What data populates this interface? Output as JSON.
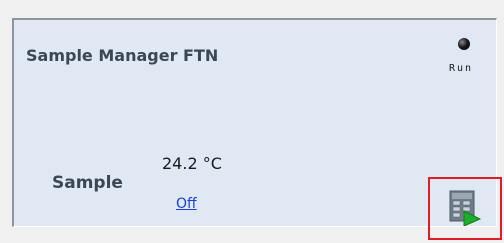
{
  "panel": {
    "title": "Sample Manager FTN",
    "status": {
      "label": "Run",
      "indicator_color": "#000000"
    },
    "sample": {
      "label": "Sample",
      "temperature": "24.2 °C",
      "state_link": "Off"
    },
    "action_icon": {
      "icon": "sample-manager-start-icon",
      "highlight_color": "#e01c24"
    }
  }
}
